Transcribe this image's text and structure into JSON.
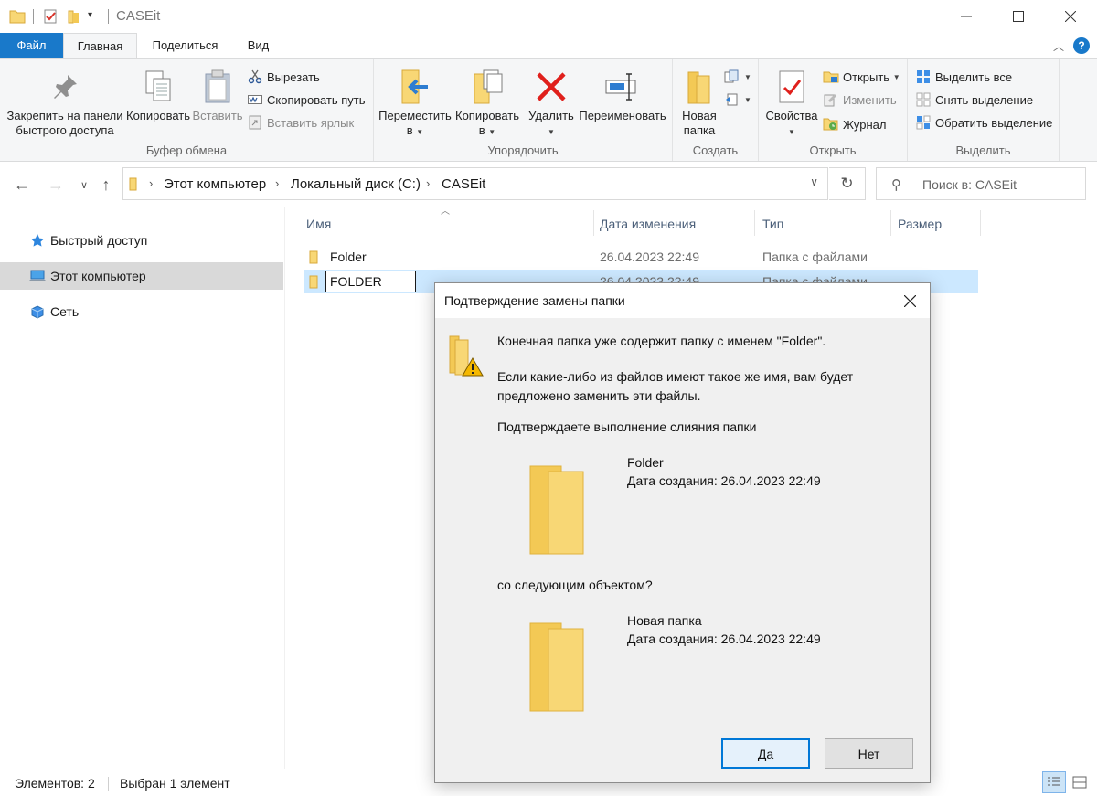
{
  "window": {
    "title": "CASEit",
    "minimize_icon": "minimize-icon",
    "maximize_icon": "maximize-icon",
    "close_icon": "close-icon"
  },
  "tabs": {
    "file": "Файл",
    "home": "Главная",
    "share": "Поделиться",
    "view": "Вид",
    "help": "?"
  },
  "ribbon": {
    "clipboard": {
      "label": "Буфер обмена",
      "pin_line1": "Закрепить на панели",
      "pin_line2": "быстрого доступа",
      "copy": "Копировать",
      "paste": "Вставить",
      "cut": "Вырезать",
      "copy_path": "Скопировать путь",
      "paste_shortcut": "Вставить ярлык"
    },
    "organize": {
      "label": "Упорядочить",
      "move_line1": "Переместить",
      "move_line2": "в",
      "copy_line1": "Копировать",
      "copy_line2": "в",
      "delete": "Удалить",
      "rename": "Переименовать"
    },
    "new": {
      "label": "Создать",
      "new_folder_line1": "Новая",
      "new_folder_line2": "папка"
    },
    "open": {
      "label": "Открыть",
      "properties": "Свойства",
      "open": "Открыть",
      "edit": "Изменить",
      "history": "Журнал"
    },
    "select": {
      "label": "Выделить",
      "select_all": "Выделить все",
      "select_none": "Снять выделение",
      "invert": "Обратить выделение"
    }
  },
  "address": {
    "crumbs": [
      "Этот компьютер",
      "Локальный диск (C:)",
      "CASEit"
    ],
    "search_placeholder": "Поиск в: CASEit"
  },
  "navpane": {
    "items": [
      {
        "label": "Быстрый доступ",
        "icon": "star-icon"
      },
      {
        "label": "Этот компьютер",
        "icon": "computer-icon"
      },
      {
        "label": "Сеть",
        "icon": "network-icon"
      }
    ]
  },
  "filelist": {
    "columns": [
      "Имя",
      "Дата изменения",
      "Тип",
      "Размер"
    ],
    "rows": [
      {
        "name": "Folder",
        "date": "26.04.2023 22:49",
        "type": "Папка с файлами"
      },
      {
        "name": "FOLDER",
        "date": "26.04.2023 22:49",
        "type": "Папка с файлами"
      }
    ]
  },
  "status": {
    "count": "Элементов: 2",
    "selected": "Выбран 1 элемент"
  },
  "dialog": {
    "title": "Подтверждение замены папки",
    "line1": "Конечная папка уже содержит папку с именем \"Folder\".",
    "line2a": "Если какие-либо из файлов имеют такое же имя, вам будет",
    "line2b": "предложено заменить эти файлы.",
    "line3": "Подтверждаете выполнение слияния папки",
    "item1_name": "Folder",
    "item1_date": "Дата создания: 26.04.2023 22:49",
    "with_text": "со следующим объектом?",
    "item2_name": "Новая папка",
    "item2_date": "Дата создания: 26.04.2023 22:49",
    "yes": "Да",
    "no": "Нет"
  },
  "colors": {
    "accent": "#1979ca",
    "selection": "#cce8ff",
    "folder": "#f8d775"
  }
}
